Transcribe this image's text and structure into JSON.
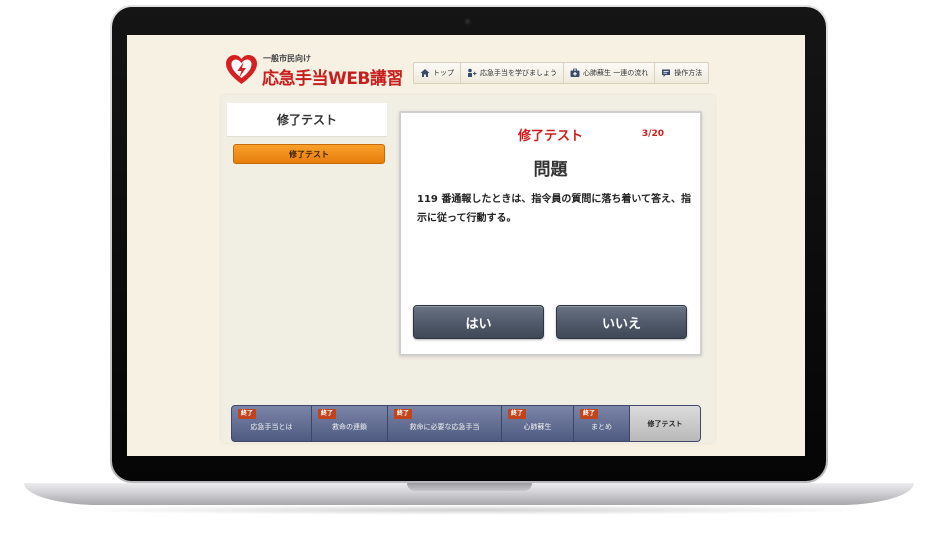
{
  "header": {
    "logo_sub": "一般市民向け",
    "logo_title": "応急手当WEB講習",
    "nav": [
      {
        "label": "トップ",
        "icon": "home-icon"
      },
      {
        "label": "応急手当を学びましょう",
        "icon": "learn-icon"
      },
      {
        "label": "心肺蘇生 一連の流れ",
        "icon": "first-aid-kit-icon"
      },
      {
        "label": "操作方法",
        "icon": "speech-bubble-icon"
      }
    ]
  },
  "sidebar": {
    "title": "修了テスト",
    "button_label": "修了テスト"
  },
  "quiz": {
    "title": "修了テスト",
    "counter": "3/20",
    "heading": "問題",
    "question": "119 番通報したときは、指令員の質問に落ち着いて答え、指示に従って行動する。",
    "yes_label": "はい",
    "no_label": "いいえ"
  },
  "tabs": [
    {
      "badge": "終了",
      "label": "応急手当とは"
    },
    {
      "badge": "終了",
      "label": "救命の連鎖"
    },
    {
      "badge": "終了",
      "label": "救命に必要な応急手当"
    },
    {
      "badge": "終了",
      "label": "心肺蘇生"
    },
    {
      "badge": "終了",
      "label": "まとめ"
    },
    {
      "badge": "",
      "label": "修了テスト"
    }
  ],
  "colors": {
    "brand_red": "#c81e1e",
    "accent_orange": "#f39218",
    "tab_navy": "#5a6689",
    "screen_bg": "#f6f1e3"
  }
}
